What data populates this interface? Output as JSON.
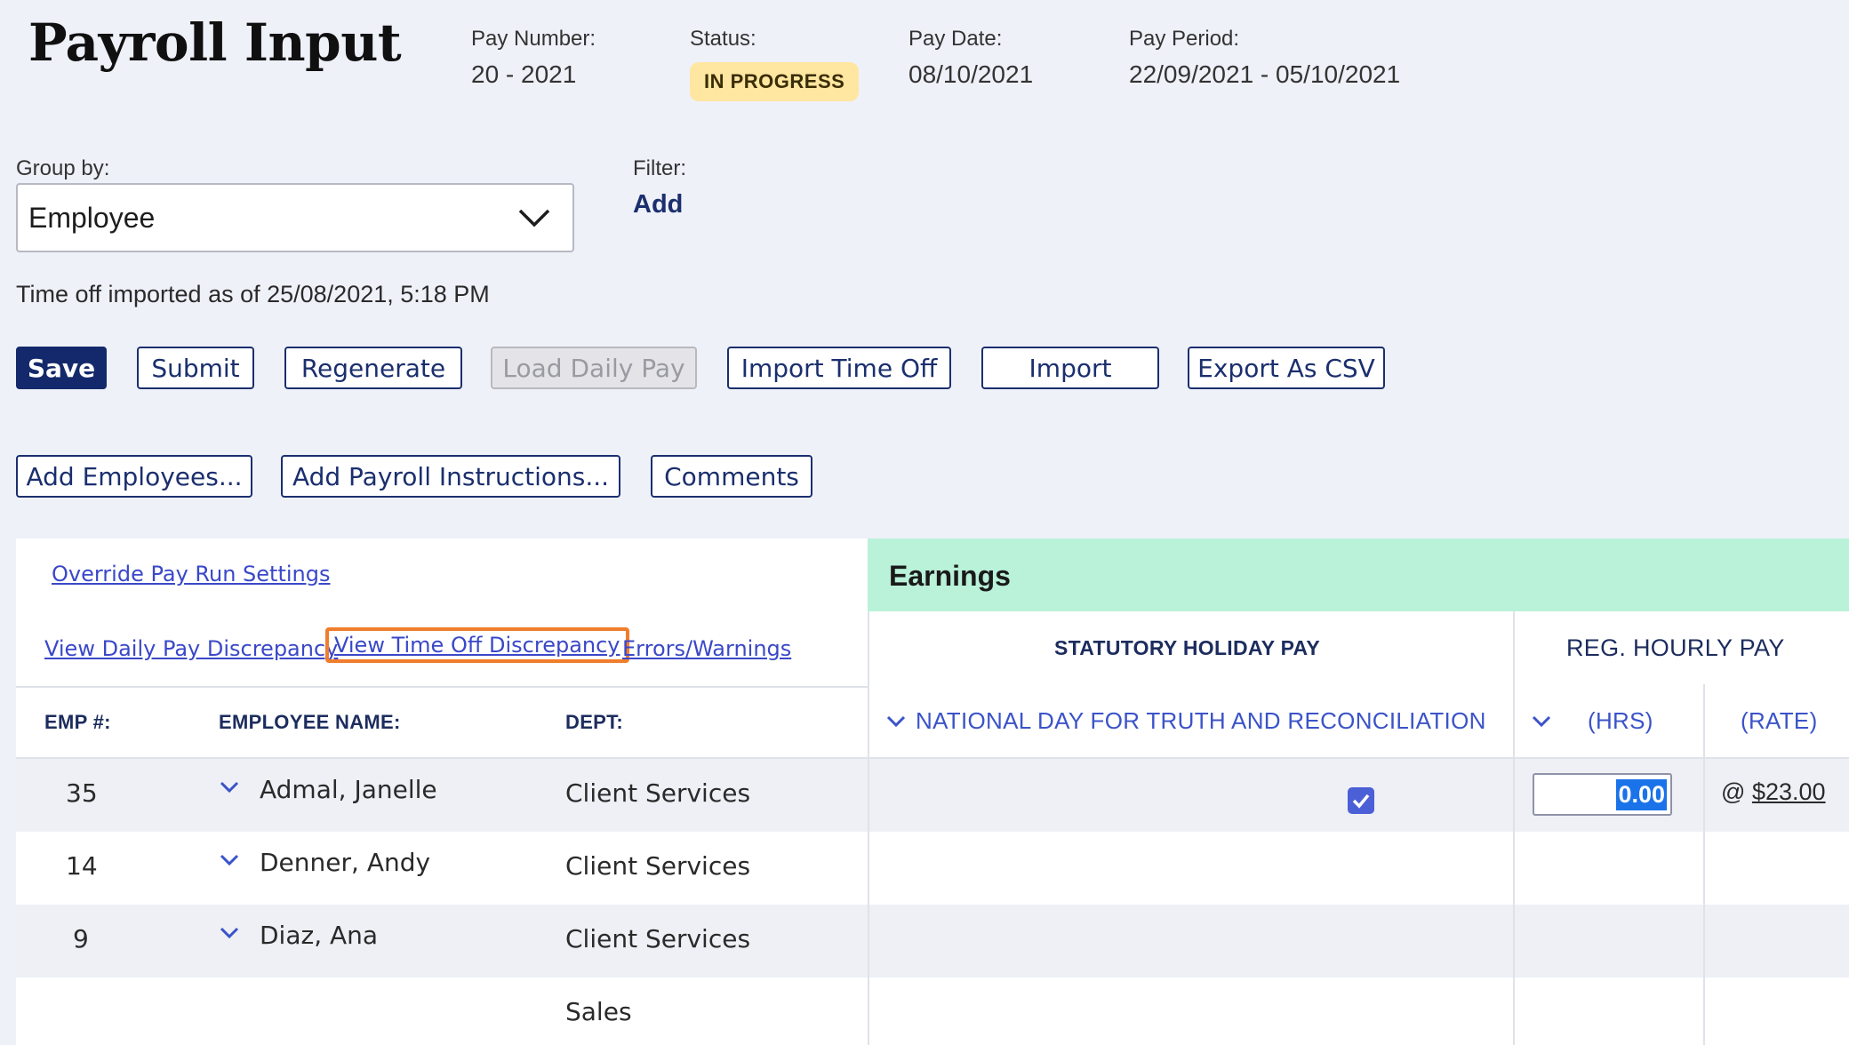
{
  "header": {
    "title": "Payroll Input",
    "pay_number_label": "Pay Number:",
    "pay_number": "20 - 2021",
    "status_label": "Status:",
    "status": "IN PROGRESS",
    "pay_date_label": "Pay Date:",
    "pay_date": "08/10/2021",
    "pay_period_label": "Pay Period:",
    "pay_period": "22/09/2021 - 05/10/2021"
  },
  "controls": {
    "group_by_label": "Group by:",
    "group_by_value": "Employee",
    "filter_label": "Filter:",
    "filter_add": "Add",
    "imported_text": "Time off imported as of 25/08/2021, 5:18 PM"
  },
  "toolbar": {
    "save": "Save",
    "submit": "Submit",
    "regenerate": "Regenerate",
    "load_daily_pay": "Load Daily Pay",
    "import_time_off": "Import Time Off",
    "import": "Import",
    "export_csv": "Export As CSV",
    "add_employees": "Add Employees...",
    "add_payroll_instructions": "Add Payroll Instructions...",
    "comments": "Comments"
  },
  "links": {
    "override": "Override Pay Run Settings",
    "daily_pay_discrepancy": "View Daily Pay Discrepancy",
    "time_off_discrepancy": "View Time Off Discrepancy",
    "errors_warnings": "Errors/Warnings"
  },
  "table": {
    "columns": {
      "emp": "EMP #:",
      "name": "EMPLOYEE NAME:",
      "dept": "DEPT:"
    },
    "earnings_title": "Earnings",
    "stat_holiday": "STATUTORY HOLIDAY PAY",
    "stat_holiday_sub": "NATIONAL DAY FOR TRUTH AND RECONCILIATION",
    "reg_hourly": "REG. HOURLY PAY",
    "hrs": "(HRS)",
    "rate": "(RATE)",
    "rows": [
      {
        "emp": "35",
        "name": "Admal, Janelle",
        "dept": "Client Services",
        "hrs": "0.00",
        "rate_prefix": "@",
        "rate": "$23.00"
      },
      {
        "emp": "14",
        "name": "Denner, Andy",
        "dept": "Client Services"
      },
      {
        "emp": "9",
        "name": "Diaz, Ana",
        "dept": "Client Services"
      },
      {
        "emp": "",
        "name": "",
        "dept": "Sales"
      }
    ]
  },
  "colors": {
    "primary": "#14296b",
    "link": "#3a48c8",
    "earnings_band": "#b9f1d9",
    "status_badge": "#ffe6a1",
    "highlight": "#f07d2c"
  }
}
